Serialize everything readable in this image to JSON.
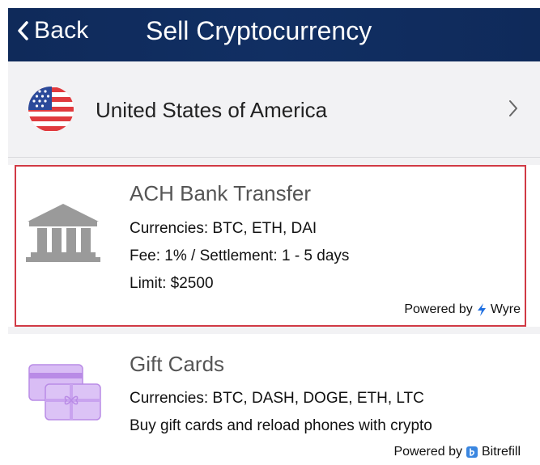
{
  "header": {
    "back_label": "Back",
    "title": "Sell Cryptocurrency"
  },
  "country": {
    "name": "United States of America",
    "flag_icon": "us-flag-icon"
  },
  "methods": [
    {
      "title": "ACH Bank Transfer",
      "currencies": "Currencies: BTC, ETH, DAI",
      "fee": "Fee: 1% / Settlement: 1 - 5 days",
      "limit": "Limit: $2500",
      "powered_by": "Powered by",
      "provider": "Wyre",
      "icon": "bank-icon",
      "selected": true
    },
    {
      "title": "Gift Cards",
      "currencies": "Currencies: BTC, DASH, DOGE, ETH, LTC",
      "description": "Buy gift cards and reload phones with crypto",
      "powered_by": "Powered by",
      "provider": "Bitrefill",
      "icon": "gift-card-icon"
    }
  ],
  "colors": {
    "header_bg": "#0f2a5a",
    "selected_border": "#d13a45",
    "bitrefill_blue": "#3a86e0",
    "wyre_blue": "#1f6fe0",
    "gift_purple": "#c9a3ef"
  }
}
